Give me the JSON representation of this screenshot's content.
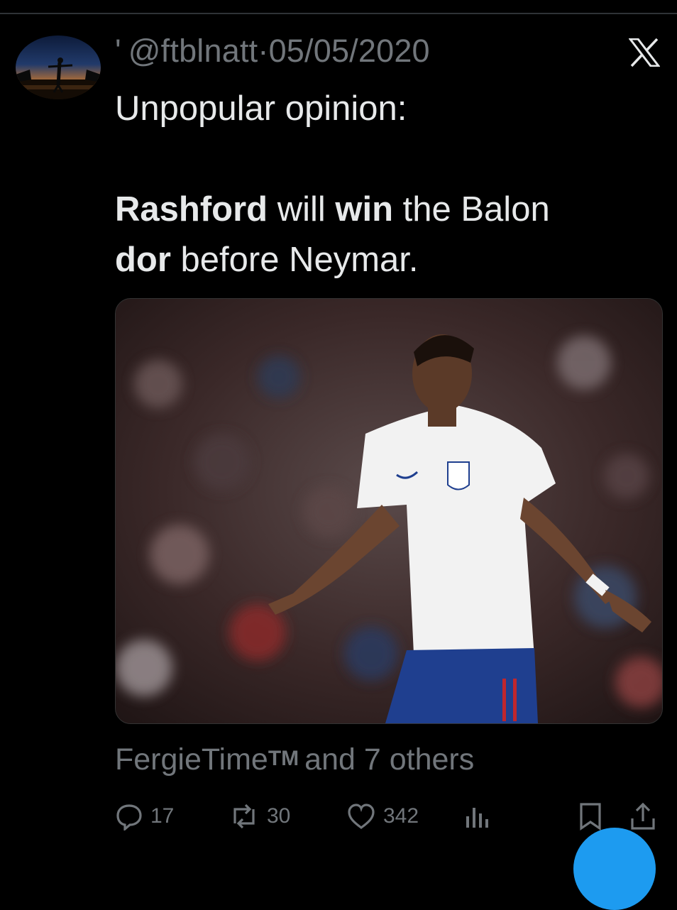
{
  "tweet": {
    "handle_prefix": "'",
    "handle": "@ftblnatt",
    "separator": "·",
    "date": "05/05/2020",
    "line1": "Unpopular opinion:",
    "w_rashford": "Rashford",
    "w_will": " will ",
    "w_win": "win",
    "w_the_balon": " the Balon",
    "w_dor": "dor",
    "w_before": " before Neymar."
  },
  "likers": {
    "name": "FergieTime",
    "tm": "TM",
    "rest": "and 7 others"
  },
  "actions": {
    "replies": "17",
    "reposts": "30",
    "likes": "342"
  },
  "icons": {
    "platform": "x-logo-icon",
    "reply": "reply-icon",
    "repost": "repost-icon",
    "like": "heart-icon",
    "views": "views-icon",
    "bookmark": "bookmark-icon",
    "share": "share-icon"
  },
  "colors": {
    "background": "#000000",
    "text": "#e7e9ea",
    "muted": "#71767b",
    "accent": "#1d9bf0"
  }
}
